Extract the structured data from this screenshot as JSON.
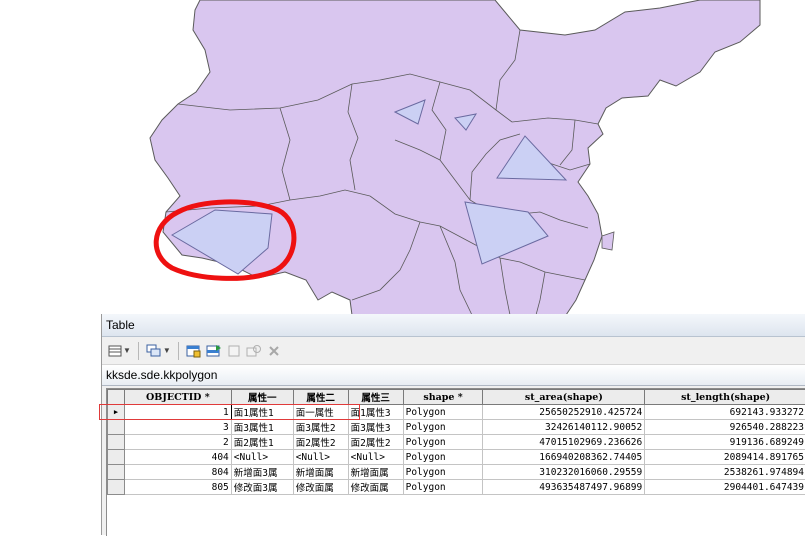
{
  "table_window": {
    "title": "Table",
    "toolbar": {
      "items": [
        "table-options",
        "related-tables",
        "select-by-attributes",
        "switch-selection",
        "clear-selection",
        "zoom-to-selected",
        "delete-selected"
      ]
    },
    "tab_label": "kksde.sde.kkpolygon",
    "columns": [
      "OBJECTID *",
      "属性一",
      "属性二",
      "属性三",
      "shape *",
      "st_area(shape)",
      "st_length(shape)"
    ],
    "rows": [
      {
        "objectid": "1",
        "a1": "面1属性1",
        "a2": "面一属性",
        "a3": "面1属性3",
        "shape": "Polygon",
        "area": "25650252910.425724",
        "length": "692143.933272",
        "current": true
      },
      {
        "objectid": "3",
        "a1": "面3属性1",
        "a2": "面3属性2",
        "a3": "面3属性3",
        "shape": "Polygon",
        "area": "32426140112.90052",
        "length": "926540.288223"
      },
      {
        "objectid": "2",
        "a1": "面2属性1",
        "a2": "面2属性2",
        "a3": "面2属性2",
        "shape": "Polygon",
        "area": "47015102969.236626",
        "length": "919136.689249"
      },
      {
        "objectid": "404",
        "a1": "<Null>",
        "a2": "<Null>",
        "a3": "<Null>",
        "shape": "Polygon",
        "area": "166940208362.74405",
        "length": "2089414.891765"
      },
      {
        "objectid": "804",
        "a1": "新增面3属",
        "a2": "新增面属",
        "a3": "新增面属",
        "shape": "Polygon",
        "area": "310232016060.29559",
        "length": "2538261.974894"
      },
      {
        "objectid": "805",
        "a1": "修改面3属",
        "a2": "修改面属",
        "a3": "修改面属",
        "shape": "Polygon",
        "area": "493635487497.96899",
        "length": "2904401.647439",
        "highlighted": true
      }
    ]
  },
  "colors": {
    "map_fill": "#d9c6ef",
    "map_border": "#5a5a5a",
    "polygon_fill": "#cbd0f4",
    "polygon_stroke": "#6a6aa0",
    "annotation_circle": "#ee1111",
    "row_highlight": "#e03a3a"
  }
}
